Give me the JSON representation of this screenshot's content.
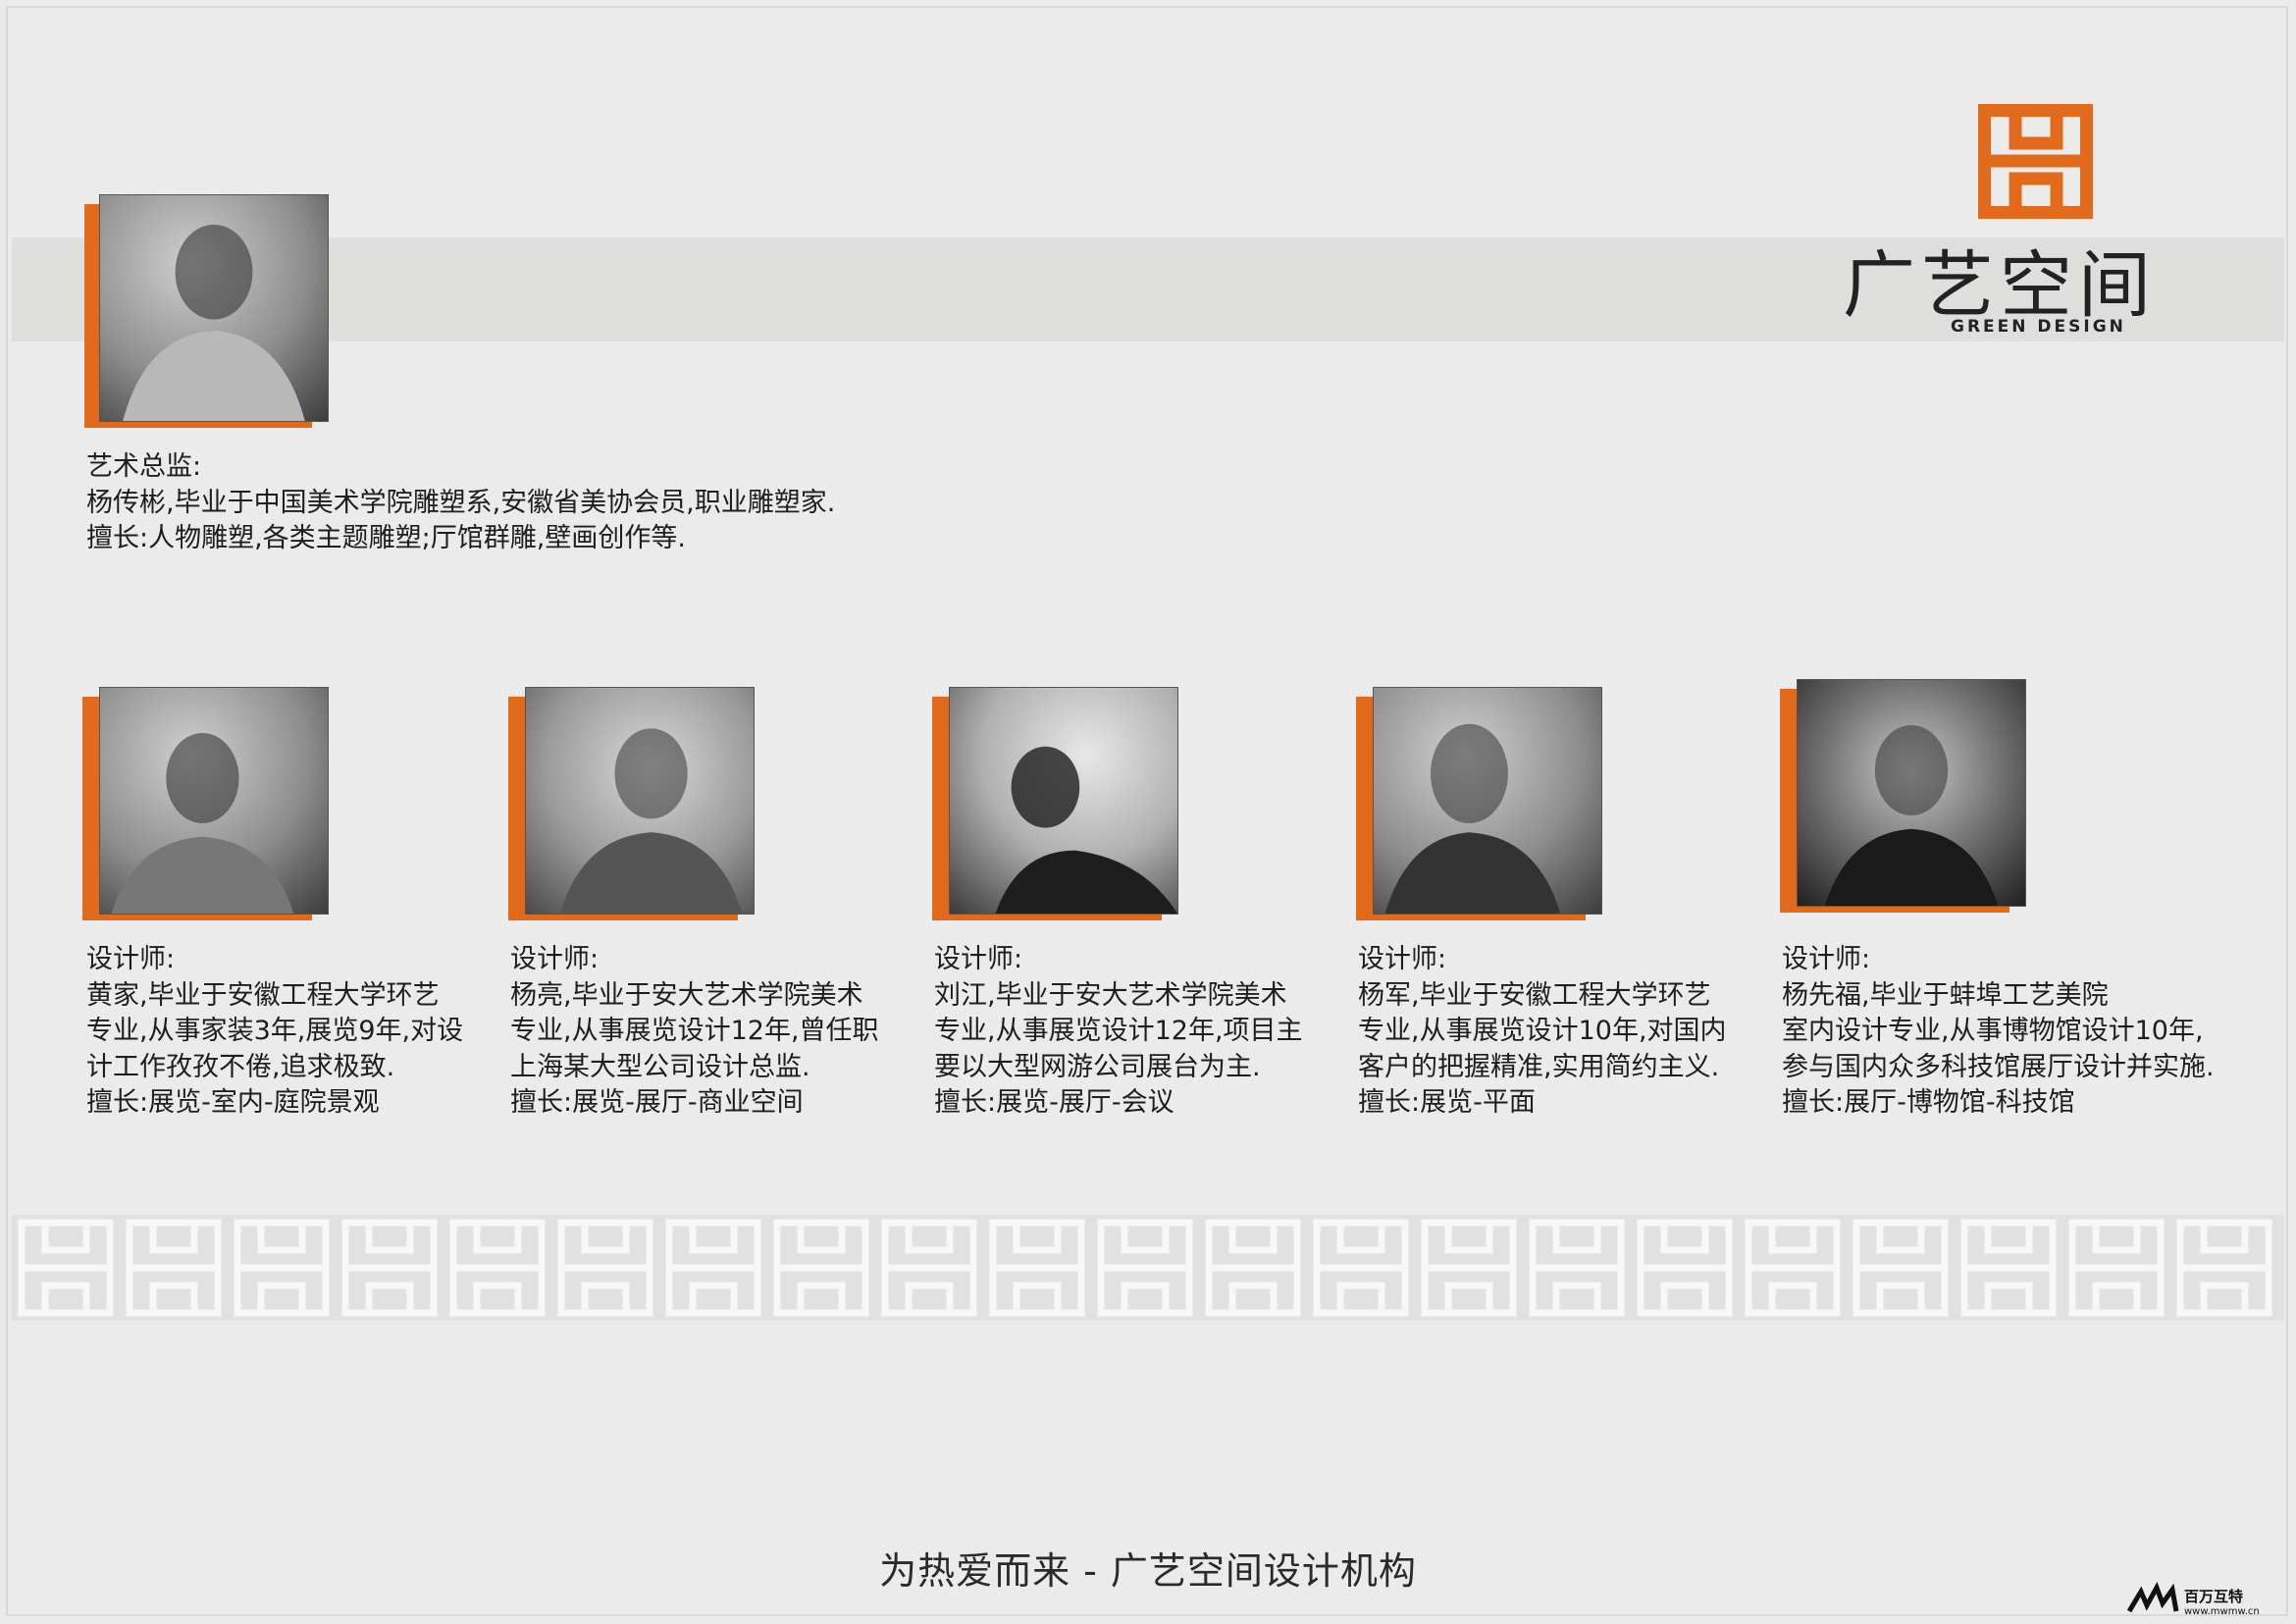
{
  "brand": {
    "name": "广艺空间",
    "sub": "GREEN DESIGN",
    "color": "#e26a1c"
  },
  "director": {
    "role": "艺术总监:",
    "desc": "杨传彬,毕业于中国美术学院雕塑系,安徽省美协会员,职业雕塑家.",
    "skill": "擅长:人物雕塑,各类主题雕塑;厅馆群雕,壁画创作等."
  },
  "designers": [
    {
      "role": "设计师:",
      "lines": [
        "黄家,毕业于安徽工程大学环艺",
        "专业,从事家装3年,展览9年,对设",
        "计工作孜孜不倦,追求极致."
      ],
      "skill": "擅长:展览-室内-庭院景观"
    },
    {
      "role": "设计师:",
      "lines": [
        "杨亮,毕业于安大艺术学院美术",
        "专业,从事展览设计12年,曾任职",
        "上海某大型公司设计总监."
      ],
      "skill": "擅长:展览-展厅-商业空间"
    },
    {
      "role": "设计师:",
      "lines": [
        "刘江,毕业于安大艺术学院美术",
        "专业,从事展览设计12年,项目主",
        "要以大型网游公司展台为主."
      ],
      "skill": "擅长:展览-展厅-会议"
    },
    {
      "role": "设计师:",
      "lines": [
        "杨军,毕业于安徽工程大学环艺",
        "专业,从事展览设计10年,对国内",
        "客户的把握精准,实用简约主义."
      ],
      "skill": "擅长:展览-平面"
    },
    {
      "role": "设计师:",
      "lines": [
        "杨先福,毕业于蚌埠工艺美院",
        "室内设计专业,从事博物馆设计10年,",
        "参与国内众多科技馆展厅设计并实施."
      ],
      "skill": "擅长:展厅-博物馆-科技馆"
    }
  ],
  "slogan": "为热爱而来 - 广艺空间设计机构",
  "watermark": {
    "label": "百万互特",
    "url": "www.mwmw.cn"
  }
}
